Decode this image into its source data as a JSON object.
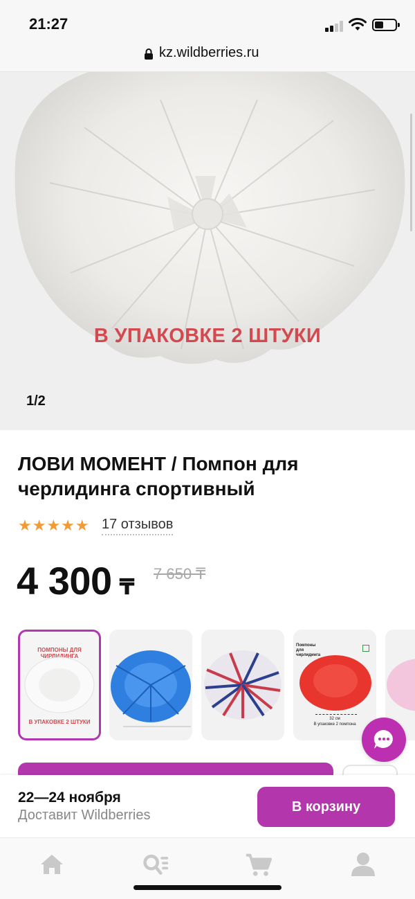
{
  "status_bar": {
    "time": "21:27"
  },
  "browser": {
    "url": "kz.wildberries.ru"
  },
  "gallery": {
    "overlay_text": "В УПАКОВКЕ 2 ШТУКИ",
    "counter": "1/2"
  },
  "product": {
    "title": "ЛОВИ МОМЕНТ / Помпон для черлидинга спортивный",
    "rating_stars": 5,
    "reviews": "17 отзывов",
    "price": "4 300",
    "currency": "₸",
    "old_price": "7 650 ₸"
  },
  "thumbnails": {
    "items": [
      {
        "title": "ПОМПОНЫ ДЛЯ ЧИРЛИДИНГА",
        "caption": "В УПАКОВКЕ 2 ШТУКИ",
        "color": "#f2f2f2"
      },
      {
        "color": "#2f7fe0"
      },
      {
        "color": "#c83b4a"
      },
      {
        "title": "Помпоны для чирлидинга",
        "caption": "32 см",
        "note": "В упаковке 2 помпона",
        "color": "#e8362e"
      },
      {
        "color": "#f4c6de"
      }
    ]
  },
  "order_bar": {
    "delivery_date": "22—24 ноября",
    "delivery_by": "Доставит Wildberries",
    "cart_button": "В корзину"
  },
  "colors": {
    "accent": "#b336ad",
    "star": "#f29a36",
    "overlay_text": "#d24a4f"
  },
  "tab_bar": {
    "icons": [
      "home-icon",
      "catalog-search-icon",
      "cart-icon",
      "profile-icon"
    ]
  }
}
